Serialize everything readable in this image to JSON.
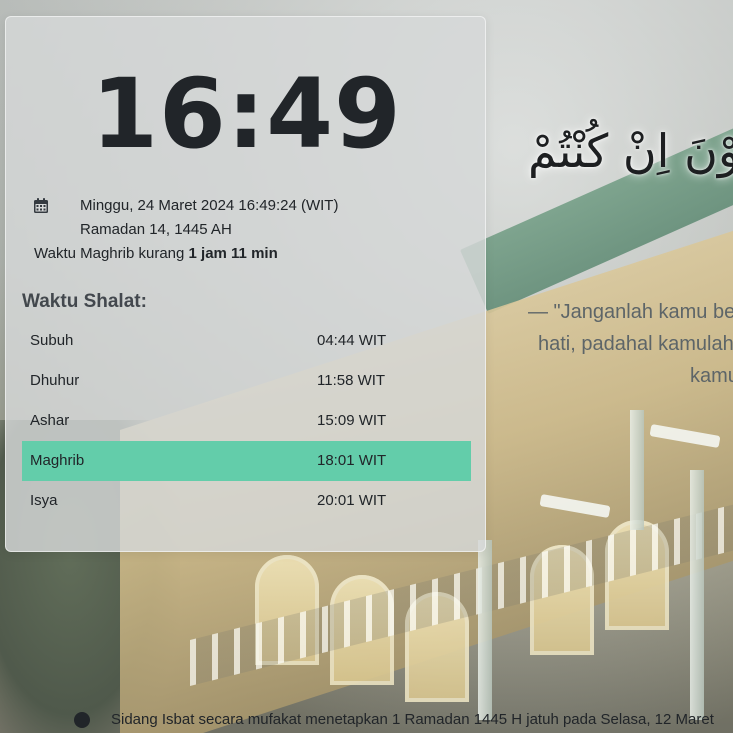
{
  "clock": {
    "time": "16:49"
  },
  "date_info": {
    "gregorian": "Minggu, 24 Maret 2024 16:49:24 (WIT)",
    "hijri": "Ramadan 14, 1445 AH",
    "countdown_prefix": "Waktu Maghrib kurang ",
    "countdown_value": "1 jam 11 min"
  },
  "prayer_section": {
    "title": "Waktu Shalat:",
    "prayers": [
      {
        "name": "Subuh",
        "time": "04:44 WIT"
      },
      {
        "name": "Dhuhur",
        "time": "11:58 WIT"
      },
      {
        "name": "Ashar",
        "time": "15:09 WIT"
      },
      {
        "name": "Maghrib",
        "time": "18:01 WIT",
        "active": true
      },
      {
        "name": "Isya",
        "time": "20:01 WIT"
      }
    ],
    "highlight_color": "#63cdaa"
  },
  "verse": {
    "arabic": "عْلَوْنَ اِنْ كُنْتُمْ",
    "translation_lines": [
      "— \"Janganlah kamu be",
      "hati, padahal kamulah",
      "kamu"
    ]
  },
  "ticker": {
    "text": "Sidang Isbat secara mufakat menetapkan 1 Ramadan 1445 H jatuh pada Selasa, 12 Maret"
  },
  "icons": {
    "calendar": "calendar-icon",
    "ticker_bullet": "bullet-icon"
  }
}
